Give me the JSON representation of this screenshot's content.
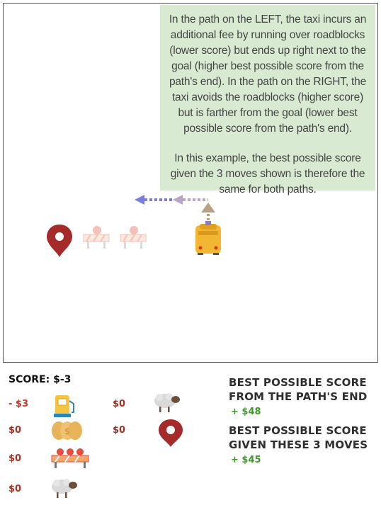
{
  "note": {
    "paragraph1": "In the path on the LEFT, the taxi incurs an additional fee by running over roadblocks (lower score) but ends up right next to the goal (higher best possible score from the path's end). In the path on the RIGHT, the taxi avoids the roadblocks (higher score) but is farther from the goal (lower best possible score from the path's end).",
    "paragraph2": "In this example, the best possible score given the 3 moves shown is therefore the same for both paths."
  },
  "legend": {
    "score_label": "SCORE: $-3",
    "gas": "- $3",
    "coins": "$0",
    "roadblock": "$0",
    "sheep_left": "$0",
    "sheep_right": "$0",
    "goal": "$0"
  },
  "summary": {
    "best_from_end_line1": "BEST POSSIBLE SCORE",
    "best_from_end_line2": "FROM THE PATH'S END",
    "best_from_end_value": "+ $48",
    "best_given_line1": "BEST POSSIBLE SCORE",
    "best_given_line2": "GIVEN THESE 3 MOVES",
    "best_given_value": "+ $45"
  },
  "colors": {
    "path_left": "#7b7be0",
    "path_right": "#b8a6c8",
    "path_up": "#b5a383",
    "goal_pin": "#a52a2a",
    "taxi": "#f2b632"
  },
  "icons": [
    "map-pin-icon",
    "roadblock-icon",
    "taxi-icon",
    "gas-pump-icon",
    "coins-icon",
    "sheep-icon"
  ]
}
